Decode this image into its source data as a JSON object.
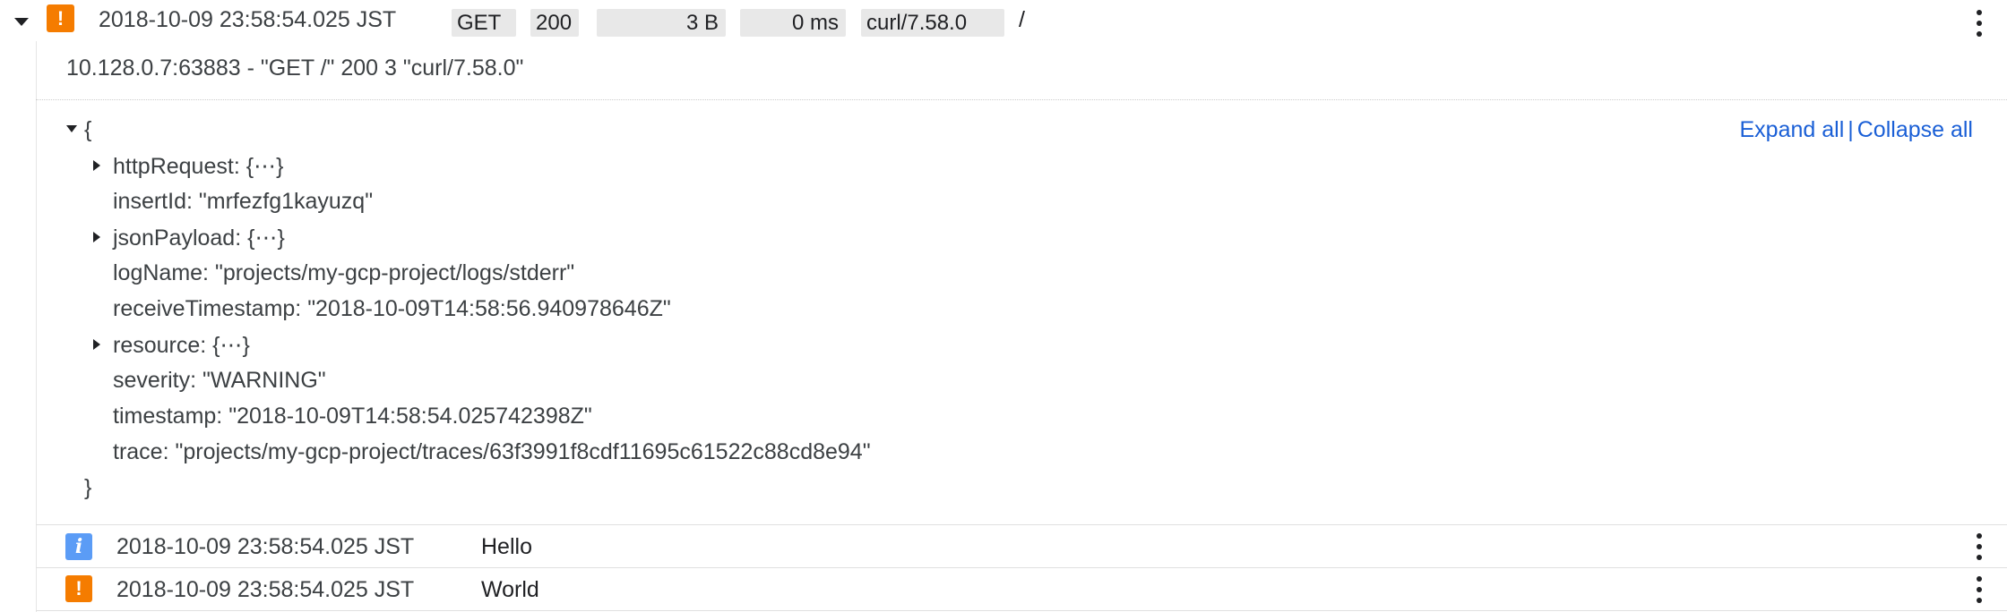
{
  "entry": {
    "timestamp": "2018-10-09 23:58:54.025 JST",
    "method": "GET",
    "status": "200",
    "size": "3 B",
    "latency": "0 ms",
    "user_agent": "curl/7.58.0",
    "path": "/",
    "severity_icon": "warning-icon",
    "summary": "10.128.0.7:63883 - \"GET /\" 200 3 \"curl/7.58.0\""
  },
  "json": {
    "open_brace": "{",
    "close_brace": "}",
    "fields": [
      {
        "key": "httpRequest: ",
        "value": "{⋯}",
        "expandable": true
      },
      {
        "key": "insertId: ",
        "value": "\"mrfezfg1kayuzq\"",
        "expandable": false
      },
      {
        "key": "jsonPayload: ",
        "value": "{⋯}",
        "expandable": true
      },
      {
        "key": "logName: ",
        "value": "\"projects/my-gcp-project/logs/stderr\"",
        "expandable": false
      },
      {
        "key": "receiveTimestamp: ",
        "value": "\"2018-10-09T14:58:56.940978646Z\"",
        "expandable": false
      },
      {
        "key": "resource: ",
        "value": "{⋯}",
        "expandable": true
      },
      {
        "key": "severity: ",
        "value": "\"WARNING\"",
        "expandable": false
      },
      {
        "key": "timestamp: ",
        "value": "\"2018-10-09T14:58:54.025742398Z\"",
        "expandable": false
      },
      {
        "key": "trace: ",
        "value": "\"projects/my-gcp-project/traces/63f3991f8cdf11695c61522c88cd8e94\"",
        "expandable": false
      }
    ],
    "expand_all": "Expand all",
    "separator": "|",
    "collapse_all": "Collapse all"
  },
  "rows": [
    {
      "severity_icon": "info-icon",
      "icon_glyph": "i",
      "timestamp": "2018-10-09 23:58:54.025 JST",
      "message": "Hello"
    },
    {
      "severity_icon": "warning-icon",
      "icon_glyph": "!",
      "timestamp": "2018-10-09 23:58:54.025 JST",
      "message": "World"
    }
  ],
  "warning_glyph": "!",
  "colors": {
    "warning": "#f57c00",
    "info": "#5b9cf6",
    "link": "#1a5fd6"
  }
}
